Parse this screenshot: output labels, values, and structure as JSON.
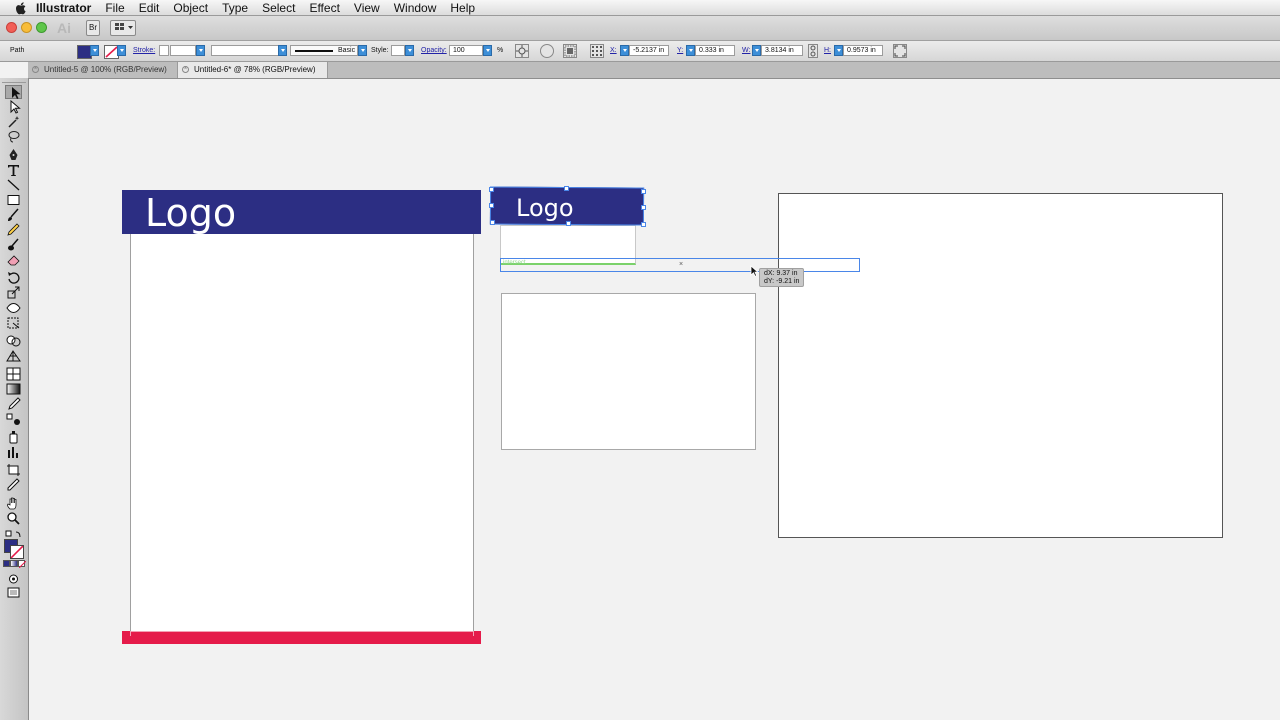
{
  "menubar": {
    "app_name": "Illustrator",
    "items": [
      "File",
      "Edit",
      "Object",
      "Type",
      "Select",
      "Effect",
      "View",
      "Window",
      "Help"
    ]
  },
  "appbar": {
    "logo": "Ai",
    "bridge_label": "Br"
  },
  "controlbar": {
    "selection_type": "Path",
    "stroke_label": "Stroke:",
    "brush_label": "Basic",
    "style_label": "Style:",
    "opacity_label": "Opacity:",
    "opacity_value": "100",
    "opacity_unit": "%",
    "x_label": "X:",
    "x_value": "-5.2137 in",
    "y_label": "Y:",
    "y_value": "0.333 in",
    "w_label": "W:",
    "w_value": "3.8134 in",
    "h_label": "H:",
    "h_value": "0.9573 in"
  },
  "tabs": [
    {
      "label": "Untitled-5 @ 100% (RGB/Preview)"
    },
    {
      "label": "Untitled-6* @ 78% (RGB/Preview)"
    }
  ],
  "toolbox": {
    "tools": [
      "selection-tool",
      "direct-selection-tool",
      "magic-wand-tool",
      "lasso-tool",
      "pen-tool",
      "type-tool",
      "line-segment-tool",
      "rectangle-tool",
      "paintbrush-tool",
      "pencil-tool",
      "blob-brush-tool",
      "eraser-tool",
      "rotate-tool",
      "scale-tool",
      "width-tool",
      "free-transform-tool",
      "shape-builder-tool",
      "perspective-grid-tool",
      "mesh-tool",
      "gradient-tool",
      "eyedropper-tool",
      "blend-tool",
      "symbol-sprayer-tool",
      "column-graph-tool",
      "artboard-tool",
      "slice-tool",
      "hand-tool",
      "zoom-tool"
    ]
  },
  "canvas": {
    "logo_text": "Logo",
    "logo_copy_text": "Logo",
    "smart_guide_hint": "intersect",
    "tooltip_dx": "dX: 9.37 in",
    "tooltip_dy": "dY: -9.21 in"
  },
  "colors": {
    "navy": "#2c2e83",
    "red": "#e51b4a",
    "selection_blue": "#4a86e8",
    "guide_green": "#7bd26b"
  }
}
